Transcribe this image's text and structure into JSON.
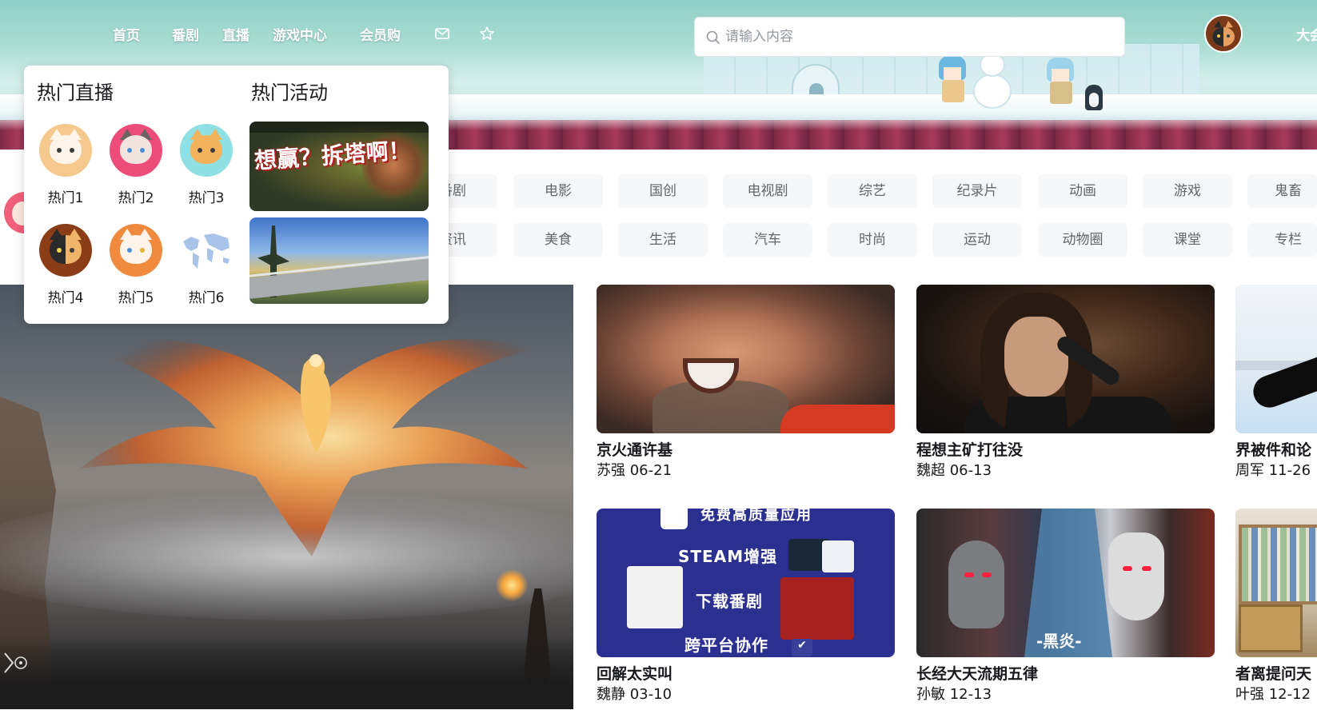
{
  "nav": {
    "links": [
      "首页",
      "番剧",
      "直播",
      "游戏中心",
      "会员购"
    ],
    "icons": [
      "mail-icon",
      "star-icon"
    ],
    "right_text": "大会"
  },
  "search": {
    "placeholder": "请输入内容",
    "value": ""
  },
  "categories": {
    "row1": [
      "番剧",
      "电影",
      "国创",
      "电视剧",
      "综艺",
      "纪录片",
      "动画",
      "游戏",
      "鬼畜"
    ],
    "row2": [
      "资讯",
      "美食",
      "生活",
      "汽车",
      "时尚",
      "运动",
      "动物圈",
      "课堂",
      "专栏"
    ]
  },
  "popover": {
    "live_heading": "热门直播",
    "activity_heading": "热门活动",
    "streamers": [
      {
        "name": "热门1"
      },
      {
        "name": "热门2"
      },
      {
        "name": "热门3"
      },
      {
        "name": "热门4"
      },
      {
        "name": "热门5"
      },
      {
        "name": "热门6"
      }
    ],
    "activities": [
      {
        "slogan": "想赢？拆塔啊！"
      },
      {
        "slogan": ""
      }
    ]
  },
  "videos": [
    {
      "title": "京火通许基",
      "author": "苏强",
      "date": "06-21"
    },
    {
      "title": "程想主矿打往没",
      "author": "魏超",
      "date": "06-13"
    },
    {
      "title": "界被件和论",
      "author": "周军",
      "date": "11-26"
    },
    {
      "title": "回解太实叫",
      "author": "魏静",
      "date": "03-10"
    },
    {
      "title": "长经大天流期五律",
      "author": "孙敏",
      "date": "12-13"
    },
    {
      "title": "者离提问天",
      "author": "叶强",
      "date": "12-12"
    }
  ],
  "thumb_text": {
    "v4_top": "免费高质量应用",
    "v4_line1": "STEAM增强",
    "v4_line2": "下载番剧",
    "v4_line3": "跨平台协作",
    "v5_label": "-黑炎-"
  },
  "colors": {
    "accent": "#00aeec",
    "category_bg": "#f6f7f8",
    "text_primary": "#18191c",
    "text_secondary": "#61666d"
  }
}
